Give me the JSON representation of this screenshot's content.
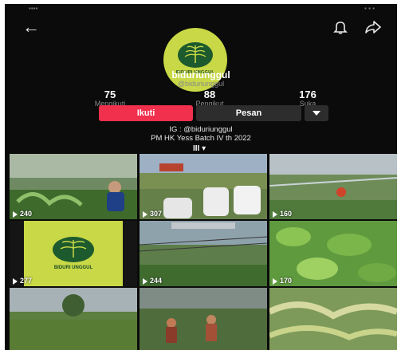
{
  "profile": {
    "avatar_text": "BIDURI UNGGUL",
    "username": "biduriunggul",
    "handle": "@biduriunggul"
  },
  "stats": [
    {
      "value": "75",
      "label": "Mengikuti"
    },
    {
      "value": "88",
      "label": "Pengikut"
    },
    {
      "value": "176",
      "label": "Suka"
    }
  ],
  "actions": {
    "follow": "Ikuti",
    "message": "Pesan",
    "more_icon": "caret-down-icon"
  },
  "bio": {
    "line1": "IG : @biduriunggul",
    "line2": "PM HK Yess Batch IV th 2022"
  },
  "grid_tab": "III ▾",
  "videos": [
    {
      "views": "240"
    },
    {
      "views": "307"
    },
    {
      "views": "160"
    },
    {
      "views": "277",
      "overlay_text": "BIDURI UNGGUL"
    },
    {
      "views": "244"
    },
    {
      "views": "170"
    },
    {
      "views": ""
    },
    {
      "views": ""
    },
    {
      "views": ""
    }
  ],
  "colors": {
    "background": "#0b0b0b",
    "follow_button": "#f0304c",
    "secondary_button": "#2d2d2d",
    "avatar_bg": "#c8d846"
  },
  "icons": {
    "back": "arrow-left-icon",
    "notification": "bell-icon",
    "share": "share-icon"
  }
}
